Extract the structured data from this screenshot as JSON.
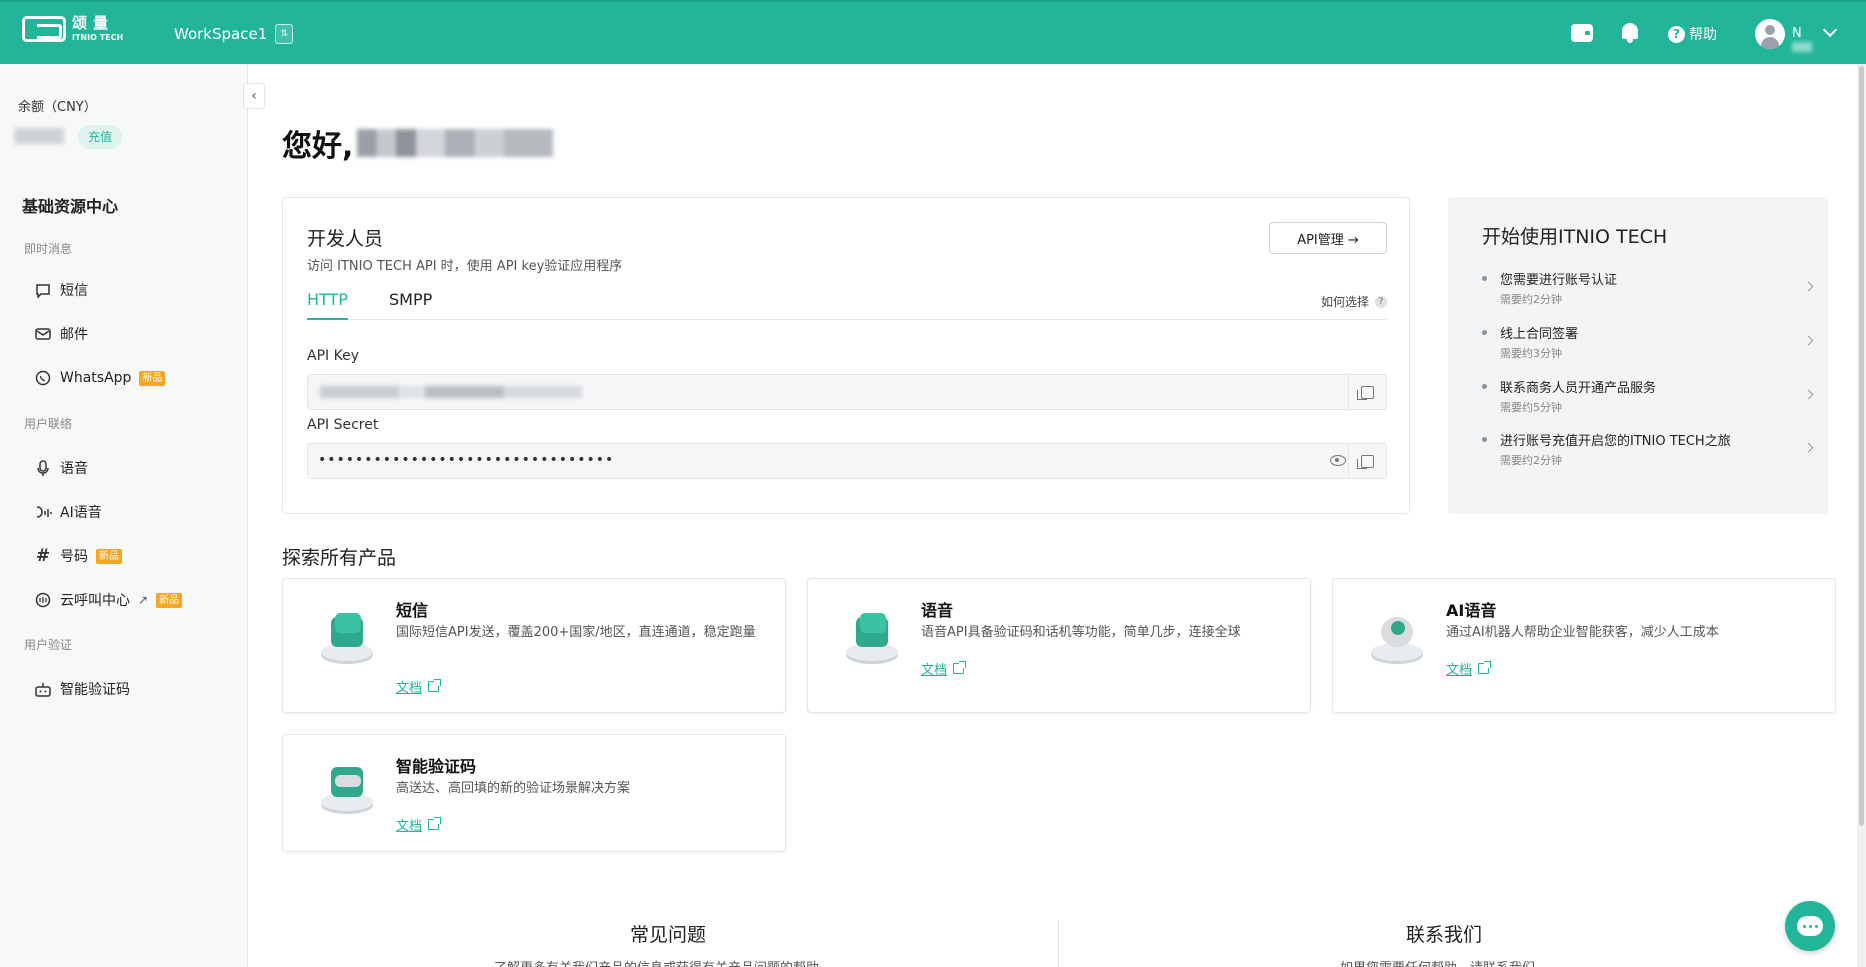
{
  "header": {
    "logo_cn": "颂量",
    "logo_en": "ITNIO TECH",
    "workspace": "WorkSpace1",
    "help": "帮助",
    "user_name": "N"
  },
  "sidebar": {
    "balance_label": "余额（CNY）",
    "recharge": "充值",
    "title": "基础资源中心",
    "groups": [
      "即时消息",
      "用户联络",
      "用户验证"
    ],
    "items": [
      {
        "label": "短信",
        "icon": "message-icon"
      },
      {
        "label": "邮件",
        "icon": "mail-icon"
      },
      {
        "label": "WhatsApp",
        "icon": "whatsapp-icon",
        "badge": "新品"
      },
      {
        "label": "语音",
        "icon": "microphone-icon"
      },
      {
        "label": "AI语音",
        "icon": "ai-voice-icon"
      },
      {
        "label": "号码",
        "icon": "hash-icon",
        "badge": "新品"
      },
      {
        "label": "云呼叫中心",
        "icon": "call-center-icon",
        "badge": "新品"
      },
      {
        "label": "智能验证码",
        "icon": "robot-icon"
      }
    ]
  },
  "main": {
    "greeting": "您好,",
    "developer": {
      "title": "开发人员",
      "subtitle": "访问 ITNIO TECH API 时，使用 API key验证应用程序",
      "api_manage": "API管理 →",
      "tabs": [
        "HTTP",
        "SMPP"
      ],
      "how_to_choose": "如何选择",
      "api_key_label": "API Key",
      "api_secret_label": "API Secret",
      "api_secret_value": "••••••••••••••••••••••••••••••••"
    },
    "getting_started": {
      "title": "开始使用ITNIO TECH",
      "steps": [
        {
          "title": "您需要进行账号认证",
          "sub": "需要约2分钟"
        },
        {
          "title": "线上合同签署",
          "sub": "需要约3分钟"
        },
        {
          "title": "联系商务人员开通产品服务",
          "sub": "需要约5分钟"
        },
        {
          "title": "进行账号充值开启您的ITNIO TECH之旅",
          "sub": "需要约2分钟"
        }
      ]
    },
    "explore_title": "探索所有产品",
    "products": [
      {
        "name": "短信",
        "desc": "国际短信API发送，覆盖200+国家/地区，直连通道，稳定跑量",
        "doc": "文档"
      },
      {
        "name": "语音",
        "desc": "语音API具备验证码和话机等功能，简单几步，连接全球",
        "doc": "文档"
      },
      {
        "name": "AI语音",
        "desc": "通过AI机器人帮助企业智能获客，减少人工成本",
        "doc": "文档"
      },
      {
        "name": "智能验证码",
        "desc": "高送达、高回填的新的验证场景解决方案",
        "doc": "文档"
      }
    ],
    "faq_title": "常见问题",
    "faq_sub": "了解更多有关我们产品的信息或获得有关产品问题的帮助",
    "contact_title": "联系我们",
    "contact_sub": "如果您需要任何帮助，请联系我们"
  },
  "colors": {
    "brand": "#22b59a",
    "badge": "#f5a623"
  }
}
